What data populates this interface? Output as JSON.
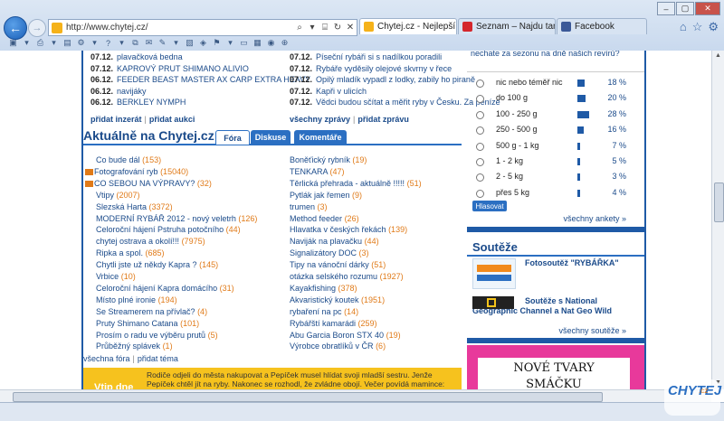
{
  "browser": {
    "url": "http://www.chytej.cz/",
    "tabs": [
      {
        "label": "Chytej.cz - Nejlepší int...",
        "active": true,
        "icon_color": "#f5b21a"
      },
      {
        "label": "Seznam – Najdu tam, co ...",
        "active": false,
        "icon_color": "#d4262c"
      },
      {
        "label": "Facebook",
        "active": false,
        "icon_color": "#3b5998"
      }
    ]
  },
  "marketplace": [
    {
      "date": "07.12.",
      "text": "plavačková bedna"
    },
    {
      "date": "07.12.",
      "text": "KAPROVÝ PRUT SHIMANO ALIVIO"
    },
    {
      "date": "06.12.",
      "text": "FEEDER BEAST MASTER AX CARP EXTRA HEAVY"
    },
    {
      "date": "06.12.",
      "text": "navijáky"
    },
    {
      "date": "06.12.",
      "text": "BERKLEY NYMPH"
    }
  ],
  "marketplace_links": {
    "add_ad": "přidat inzerát",
    "add_auction": "přidat aukci",
    "sep": "|"
  },
  "news": [
    {
      "date": "07.12.",
      "text": "Píseční rybáři si s nadílkou poradili"
    },
    {
      "date": "07.12.",
      "text": "Rybáře vyděsily olejové skvrny v řece"
    },
    {
      "date": "07.12.",
      "text": "Opilý mladík vypadl z lodky, zabily ho piraně"
    },
    {
      "date": "07.12.",
      "text": "Kapři v ulicích"
    },
    {
      "date": "07.12.",
      "text": "Vědci budou sčítat a měřit ryby v Česku. Za peníze"
    }
  ],
  "news_links": {
    "all": "všechny zprávy",
    "add": "přidat zprávu",
    "sep": "|"
  },
  "section": {
    "title": "Aktuálně na Chytej.cz",
    "tabs": [
      "Fóra",
      "Diskuse",
      "Komentáře"
    ]
  },
  "forum_left": [
    {
      "t": "Co bude dál",
      "c": "(153)",
      "icon": false
    },
    {
      "t": "Fotografování ryb",
      "c": "(15040)",
      "icon": true
    },
    {
      "t": "CO SEBOU NA VÝPRAVY?",
      "c": "(32)",
      "icon": true
    },
    {
      "t": "Vtipy",
      "c": "(2007)",
      "icon": false
    },
    {
      "t": "Slezská Harta",
      "c": "(3372)",
      "icon": false
    },
    {
      "t": "MODERNÍ RYBÁŘ 2012 - nový veletrh",
      "c": "(126)",
      "icon": false
    },
    {
      "t": "Celoroční hájení Pstruha potočního",
      "c": "(44)",
      "icon": false
    },
    {
      "t": "chytej ostrava a okolí!!!",
      "c": "(7975)",
      "icon": false
    },
    {
      "t": "Ripka a spol.",
      "c": "(685)",
      "icon": false
    },
    {
      "t": "Chytli jste už někdy Kapra ?",
      "c": "(145)",
      "icon": false
    },
    {
      "t": "Vrbice",
      "c": "(10)",
      "icon": false
    },
    {
      "t": "Celoroční hájení Kapra domácího",
      "c": "(31)",
      "icon": false
    },
    {
      "t": "Místo plné ironie",
      "c": "(194)",
      "icon": false
    },
    {
      "t": "Se Streamerem na přívlač?",
      "c": "(4)",
      "icon": false
    },
    {
      "t": "Pruty Shimano Catana",
      "c": "(101)",
      "icon": false
    },
    {
      "t": "Prosím o radu ve výběru prutů",
      "c": "(5)",
      "icon": false
    },
    {
      "t": "Průběžný splávek",
      "c": "(1)",
      "icon": false
    }
  ],
  "forum_right": [
    {
      "t": "Boněťický rybník",
      "c": "(19)"
    },
    {
      "t": "TENKARA",
      "c": "(47)"
    },
    {
      "t": "Těrlická přehrada - aktuálně !!!!!",
      "c": "(51)"
    },
    {
      "t": "Pytlák jak řemen",
      "c": "(9)"
    },
    {
      "t": "trumen",
      "c": "(3)"
    },
    {
      "t": "Method feeder",
      "c": "(26)"
    },
    {
      "t": "Hlavatka v českých řekách",
      "c": "(139)"
    },
    {
      "t": "Naviják na plavačku",
      "c": "(44)"
    },
    {
      "t": "Signalizátory DOC",
      "c": "(3)"
    },
    {
      "t": "Tipy na vánoční dárky",
      "c": "(51)"
    },
    {
      "t": "otázka selského rozumu",
      "c": "(1927)"
    },
    {
      "t": "Kayakfishing",
      "c": "(378)"
    },
    {
      "t": "Akvaristický koutek",
      "c": "(1951)"
    },
    {
      "t": "rybaření na pc",
      "c": "(14)"
    },
    {
      "t": "Rybářští kamarádi",
      "c": "(259)"
    },
    {
      "t": "Abu Garcia Boron STX 40",
      "c": "(19)"
    },
    {
      "t": "Výrobce obratlíků v ČR",
      "c": "(6)"
    }
  ],
  "forum_links": {
    "all": "všechna fóra",
    "add": "přidat téma",
    "sep": "|"
  },
  "story": {
    "label": "Vtip dne",
    "text": "Rodiče odjeli do města nakupovat a Pepíček musel hlídat svoji mladší sestru. Jenže Pepíček chtěl jít na ryby. Nakonec se rozhodl, že zvládne obojí. Večer povídá mamince: „Tohle už víckrát"
  },
  "poll": {
    "question": "nechate za sezonu na dně našich revírů?",
    "options": [
      {
        "label": "nic nebo téměř nic",
        "pct": 18,
        "pct_text": "18 %"
      },
      {
        "label": "do 100 g",
        "pct": 20,
        "pct_text": "20 %"
      },
      {
        "label": "100 - 250 g",
        "pct": 28,
        "pct_text": "28 %"
      },
      {
        "label": "250 - 500 g",
        "pct": 16,
        "pct_text": "16 %"
      },
      {
        "label": "500 g - 1 kg",
        "pct": 7,
        "pct_text": "7 %"
      },
      {
        "label": "1 - 2 kg",
        "pct": 5,
        "pct_text": "5 %"
      },
      {
        "label": "2 - 5 kg",
        "pct": 3,
        "pct_text": "3 %"
      },
      {
        "label": "přes 5 kg",
        "pct": 4,
        "pct_text": "4 %"
      }
    ],
    "vote_label": "Hlasovat",
    "all_label": "všechny ankety »"
  },
  "contests": {
    "title": "Soutěže",
    "item1": "Fotosoutěž \"RYBÁŘKA\"",
    "item2": "Soutěže s National Geographic Channel a Nat Geo Wild",
    "all_label": "všechny soutěže »"
  },
  "ad": {
    "line1": "NOVÉ TVARY",
    "line2": "SMÁČKU"
  },
  "watermark": {
    "text": "CHYTEJ",
    "suffix": ".cz"
  },
  "colors": {
    "brand_blue": "#1f5aa6",
    "orange": "#e07a18",
    "pink": "#e8399b"
  }
}
